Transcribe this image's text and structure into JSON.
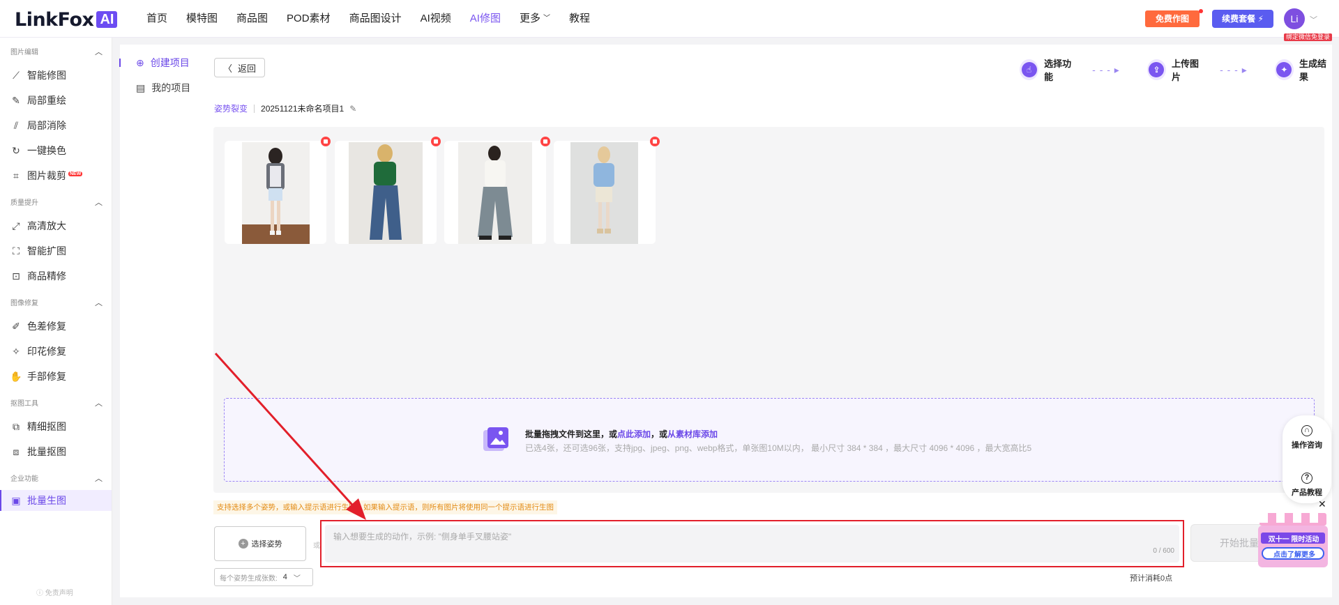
{
  "brand": {
    "name": "LinkFox",
    "badge": "AI"
  },
  "nav": [
    {
      "label": "首页"
    },
    {
      "label": "模特图"
    },
    {
      "label": "商品图"
    },
    {
      "label": "POD素材"
    },
    {
      "label": "商品图设计"
    },
    {
      "label": "AI视频"
    },
    {
      "label": "AI修图"
    },
    {
      "label": "更多"
    },
    {
      "label": "教程"
    }
  ],
  "header": {
    "free_btn": "免费作图",
    "renew_btn": "续费套餐 ⚡",
    "avatar": "Li",
    "bind_badge": "绑定微信免登录"
  },
  "sidebar": {
    "sections": [
      {
        "title": "图片编辑",
        "items": [
          "智能修图",
          "局部重绘",
          "局部消除",
          "一键换色",
          "图片裁剪"
        ]
      },
      {
        "title": "质量提升",
        "items": [
          "高清放大",
          "智能扩图",
          "商品精修"
        ]
      },
      {
        "title": "图像修复",
        "items": [
          "色差修复",
          "印花修复",
          "手部修复"
        ]
      },
      {
        "title": "抠图工具",
        "items": [
          "精细抠图",
          "批量抠图"
        ]
      },
      {
        "title": "企业功能",
        "items": [
          "批量生图"
        ]
      }
    ],
    "new_tag": "NEW",
    "disclaimer": "免责声明"
  },
  "projects": {
    "create": "创建项目",
    "mine": "我的项目"
  },
  "main": {
    "back": "返回",
    "steps": [
      "选择功能",
      "上传图片",
      "生成结果"
    ],
    "crumb_feature": "姿势裂变",
    "project_name": "20251121未命名项目1",
    "upload_line1_a": "批量拖拽文件到这里，或",
    "upload_line1_link1": "点此添加",
    "upload_line1_b": "，或",
    "upload_line1_link2": "从素材库添加",
    "upload_line2": "已选4张，还可选96张，支持jpg、jpeg、png、webp格式，单张图10M以内， 最小尺寸 384 * 384 ，最大尺寸 4096 * 4096 ，最大宽高比5",
    "hint": "支持选择多个姿势，或输入提示语进行生图，如果输入提示语，则所有图片将使用同一个提示语进行生图",
    "pose_btn": "选择姿势",
    "count_label": "每个姿势生成张数:",
    "count_value": "4",
    "prompt_placeholder": "输入想要生成的动作，示例: \"侧身单手叉腰站姿\"",
    "prompt_counter": "0 / 600",
    "start_btn": "开始批量",
    "cost": "预计消耗0点"
  },
  "float": {
    "consult": "操作咨询",
    "tutorial": "产品教程"
  },
  "promo": {
    "line1": "双十一 限时活动",
    "line2": "点击了解更多"
  },
  "colors": {
    "accent": "#7a55f0",
    "highlight": "#e21f2a",
    "free": "#ff6a3d",
    "renew": "#5a5cf0"
  }
}
